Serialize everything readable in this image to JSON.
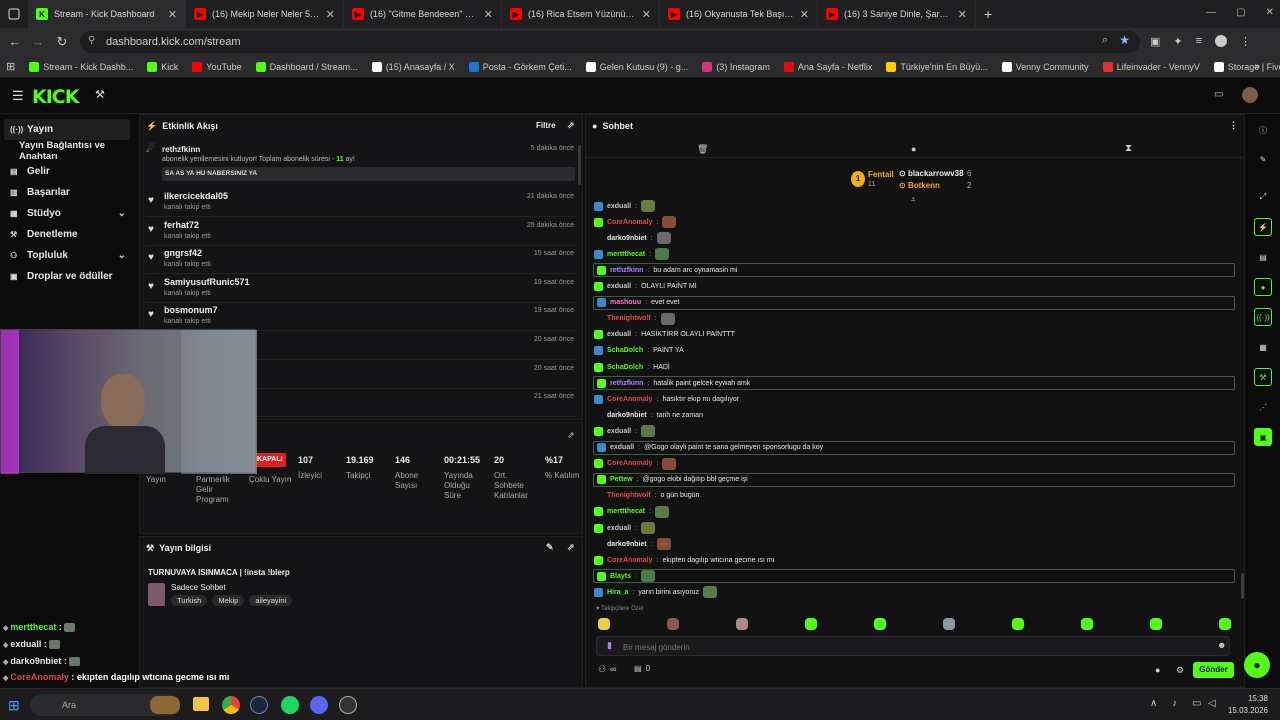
{
  "browser": {
    "tabs": [
      {
        "label": "Stream - Kick Dashboard",
        "icon": "kick-icon",
        "color": "#53fc18"
      },
      {
        "label": "(16) Mekip Neler Neler 54.Bölü",
        "icon": "youtube-icon",
        "color": "#ff0000"
      },
      {
        "label": "(16) \"Gitme Bendeeen\" Kick &",
        "icon": "youtube-icon",
        "color": "#ff0000"
      },
      {
        "label": "(16) Rica Etsem Yüzünüzü Gülü",
        "icon": "youtube-icon",
        "color": "#ff0000"
      },
      {
        "label": "(16) Okyanusta Tek Başına Bulu",
        "icon": "youtube-icon",
        "color": "#ff0000"
      },
      {
        "label": "(16) 3 Saniye Dinle, Şarkıyı Bul",
        "icon": "youtube-icon",
        "color": "#ff0000"
      }
    ],
    "new_tab": "+",
    "url": "dashboard.kick.com/stream",
    "bookmarks": [
      {
        "label": "Stream - Kick Dashb...",
        "color": "#53fc18"
      },
      {
        "label": "Kick",
        "color": "#53fc18"
      },
      {
        "label": "YouTube",
        "color": "#ff0000"
      },
      {
        "label": "Dashboard / Stream...",
        "color": "#53fc18"
      },
      {
        "label": "(15) Anasayfa / X",
        "color": "#ffffff"
      },
      {
        "label": "Posta - Görkem Çeti...",
        "color": "#1e73d2"
      },
      {
        "label": "Gelen Kutusu (9) - g...",
        "color": "#ffffff"
      },
      {
        "label": "(3) Instagram",
        "color": "#d63384"
      },
      {
        "label": "Ana Sayfa - Netflix",
        "color": "#e50914"
      },
      {
        "label": "Türkiye'nin En Büyü...",
        "color": "#ffcc00"
      },
      {
        "label": "Venny Community",
        "color": "#ffffff"
      },
      {
        "label": "Lifeinvader - VennyV",
        "color": "#e03030"
      },
      {
        "label": "Storage | Fivemanage",
        "color": "#ffffff"
      }
    ]
  },
  "nav": {
    "items": [
      {
        "label": "Yayın",
        "icon": "broadcast-icon"
      },
      {
        "label": "Yayın Bağlantısı ve Anahtarı",
        "icon": ""
      },
      {
        "label": "Gelir",
        "icon": "wallet-icon"
      },
      {
        "label": "Başarılar",
        "icon": "trophy-icon"
      },
      {
        "label": "Stüdyo",
        "icon": "studio-icon"
      },
      {
        "label": "Denetleme",
        "icon": "hammer-icon"
      },
      {
        "label": "Topluluk",
        "icon": "community-icon"
      },
      {
        "label": "Droplar ve ödüller",
        "icon": "gift-icon"
      }
    ]
  },
  "activity": {
    "title": "Etkinlik Akışı",
    "filter": "Filtre",
    "sub_event": {
      "user": "rethzfkinn",
      "text_a": "abonelik yenilemesini kutluyor! Toplam abonelik süresi - ",
      "months": "11",
      "text_b": " ay!",
      "message": "SA AS YA HU NABERSINIZ YA",
      "time": "5 dakika önce"
    },
    "events": [
      {
        "user": "ilkercicekdal05",
        "action": "kanalı takip etti",
        "time": "21 dakika önce"
      },
      {
        "user": "ferhat72",
        "action": "kanalı takip etti",
        "time": "25 dakika önce"
      },
      {
        "user": "gngrsf42",
        "action": "kanalı takip etti",
        "time": "15 saat önce"
      },
      {
        "user": "SamiyusufRunic571",
        "action": "kanalı takip etti",
        "time": "19 saat önce"
      },
      {
        "user": "bosmonum7",
        "action": "kanalı takip etti",
        "time": "19 saat önce"
      },
      {
        "user": "",
        "action": "",
        "time": "20 saat önce"
      },
      {
        "user": "",
        "action": "",
        "time": "20 saat önce"
      },
      {
        "user": "",
        "action": "",
        "time": "21 saat önce"
      }
    ]
  },
  "stats": {
    "status": "KAPALI",
    "items": [
      {
        "value": "",
        "label": "Yayın"
      },
      {
        "value": "",
        "label": "Partnerlik Gelir Programı"
      },
      {
        "value": "",
        "label": "Çoklu Yayın"
      },
      {
        "value": "107",
        "label": "İzleyici"
      },
      {
        "value": "19.169",
        "label": "Takipçi"
      },
      {
        "value": "146",
        "label": "Abone Sayısı"
      },
      {
        "value": "00:21:55",
        "label": "Yayında Olduğu Süre"
      },
      {
        "value": "20",
        "label": "Ort. Sohbete Katılanlar"
      },
      {
        "value": "%17",
        "label": "% Katılım"
      }
    ]
  },
  "stream_info": {
    "title": "Yayın bilgisi",
    "stream_title": "TURNUVAYA ISINMACA | !insta !blerp",
    "category": "Sadece Sohbet",
    "tags": [
      "Turkish",
      "Mekip",
      "aileyayini"
    ]
  },
  "chat": {
    "title": "Sohbet",
    "leaderboard": [
      {
        "rank": "1",
        "name": "Fentail",
        "value": "11"
      },
      {
        "name": "blackarrowv38",
        "value": "6"
      },
      {
        "name": "Botkenn",
        "value": "2"
      }
    ],
    "messages": [
      {
        "user": "exduall",
        "color": "#c4c4c4",
        "text": "",
        "emote": true,
        "hl": false
      },
      {
        "user": "CoreAnomaly",
        "color": "#e04848",
        "text": "",
        "emote": true,
        "hl": false
      },
      {
        "user": "darko9nbiet",
        "color": "#e8e8e8",
        "text": "",
        "emote": true,
        "hl": false
      },
      {
        "user": "merttthecat",
        "color": "#53fc18",
        "text": "",
        "emote": true,
        "hl": false
      },
      {
        "user": "rethzfkinn",
        "color": "#b17cff",
        "text": "bu adam arc oynamasin mi",
        "emote": false,
        "hl": true
      },
      {
        "user": "exduall",
        "color": "#c4c4c4",
        "text": "OLAYLI PAİNT Mİ",
        "emote": false,
        "hl": false
      },
      {
        "user": "mashouu",
        "color": "#ff7bd0",
        "text": "evet evet",
        "emote": false,
        "hl": true
      },
      {
        "user": "Thenightwolf",
        "color": "#e04848",
        "text": "",
        "emote": true,
        "hl": false
      },
      {
        "user": "exduall",
        "color": "#c4c4c4",
        "text": "HASİKTİRR OLAYLI PAİNTTT",
        "emote": false,
        "hl": false
      },
      {
        "user": "SchaDolch",
        "color": "#53fc18",
        "text": "PAİNT YA",
        "emote": false,
        "hl": false
      },
      {
        "user": "SchaDolch",
        "color": "#53fc18",
        "text": "HADİ",
        "emote": false,
        "hl": false
      },
      {
        "user": "rethzfkinn",
        "color": "#b17cff",
        "text": "hatalik paint gelcek eywah amk",
        "emote": false,
        "hl": true
      },
      {
        "user": "CoreAnomaly",
        "color": "#e04848",
        "text": "hasıktır ekıp mı dagılıyor",
        "emote": false,
        "hl": false
      },
      {
        "user": "darko9nbiet",
        "color": "#e8e8e8",
        "text": "tarih ne zaman",
        "emote": false,
        "hl": false
      },
      {
        "user": "exduall",
        "color": "#c4c4c4",
        "text": "",
        "emote": true,
        "hl": false
      },
      {
        "user": "exduall",
        "color": "#c4c4c4",
        "text": "@Gogo olayli paint te sana gelmeyen sponsorlugu da koy",
        "emote": false,
        "hl": true
      },
      {
        "user": "CoreAnomaly",
        "color": "#e04848",
        "text": "",
        "emote": true,
        "hl": false
      },
      {
        "user": "Pettew",
        "color": "#53fc18",
        "text": "@gogo ekibi dağıtıp bbl geçme işi",
        "emote": false,
        "hl": true
      },
      {
        "user": "Thenightwolf",
        "color": "#e04848",
        "text": "o gün bugün",
        "emote": false,
        "hl": false
      },
      {
        "user": "merttthecat",
        "color": "#53fc18",
        "text": "",
        "emote": true,
        "hl": false
      },
      {
        "user": "exduall",
        "color": "#c4c4c4",
        "text": "",
        "emote": true,
        "hl": false
      },
      {
        "user": "darko9nbiet",
        "color": "#e8e8e8",
        "text": "",
        "emote": true,
        "hl": false
      },
      {
        "user": "CoreAnomaly",
        "color": "#e04848",
        "text": "ekıpten dagılıp wtıcına gecme ısı mı",
        "emote": false,
        "hl": false
      },
      {
        "user": "Blayts",
        "color": "#53fc18",
        "text": "",
        "emote": true,
        "hl": true
      },
      {
        "user": "Hira_a",
        "color": "#53fc18",
        "text": "yarın birini asıyoruz",
        "emote": true,
        "hl": false
      }
    ],
    "followers_only_label": "Takipçilere Özel",
    "input_placeholder": "Bir mesaj gönderin",
    "infinity": "∞",
    "count": "0",
    "send": "Gönder"
  },
  "overlay": {
    "lines": [
      {
        "user": "mertthecat",
        "color": "#53fc18",
        "text": ""
      },
      {
        "user": "exduall",
        "color": "#e8e8e8",
        "text": ""
      },
      {
        "user": "darko9nbiet",
        "color": "#e8e8e8",
        "text": ""
      },
      {
        "user": "CoreAnomaly",
        "color": "#e04848",
        "text": "ekıpten dagılıp wtıcına gecme ısı mı"
      },
      {
        "user": "Blayts",
        "color": "#53fc18",
        "text": ""
      },
      {
        "user": "",
        "color": "#e8e8e8",
        "text": "rini asıyoruz"
      }
    ]
  },
  "taskbar": {
    "search": "Ara",
    "time": "15:38",
    "date": "15.03.2026"
  },
  "colors": {
    "brand": "#53fc18",
    "bg": "#0f0f10",
    "panel": "#141416"
  }
}
